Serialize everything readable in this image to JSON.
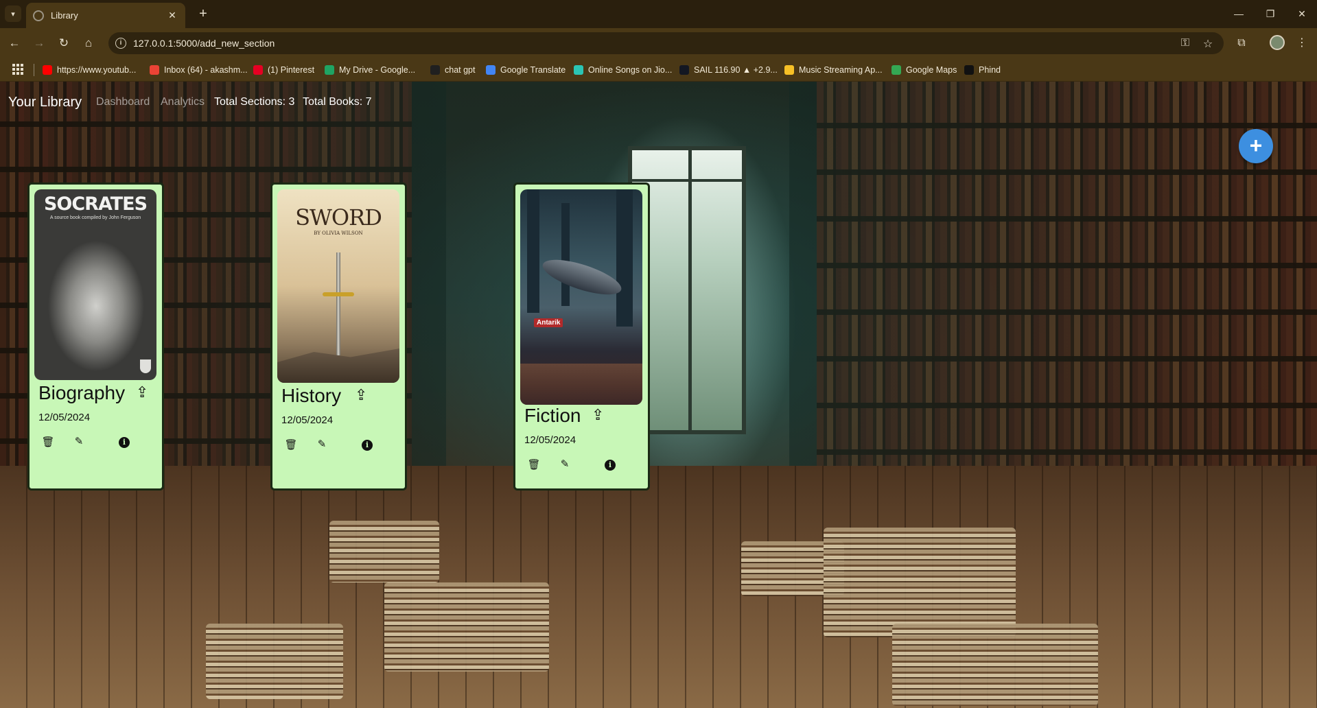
{
  "browser": {
    "tab_title": "Library",
    "url": "127.0.0.1:5000/add_new_section",
    "bookmarks": [
      {
        "label": "https://www.youtub...",
        "icon": "youtube-icon",
        "color": "#ff0000"
      },
      {
        "label": "Inbox (64) - akashm...",
        "icon": "gmail-icon",
        "color": "#ea4335"
      },
      {
        "label": "(1) Pinterest",
        "icon": "pinterest-icon",
        "color": "#e60023"
      },
      {
        "label": "My Drive - Google...",
        "icon": "google-drive-icon",
        "color": "#1fa463"
      },
      {
        "label": "chat gpt",
        "icon": "chatgpt-icon",
        "color": "#202020"
      },
      {
        "label": "Google Translate",
        "icon": "google-translate-icon",
        "color": "#4285f4"
      },
      {
        "label": "Online Songs on Jio...",
        "icon": "jiosaavn-icon",
        "color": "#2bc5b4"
      },
      {
        "label": "SAIL 116.90 ▲ +2.9...",
        "icon": "tradingview-icon",
        "color": "#131722"
      },
      {
        "label": "Music Streaming Ap...",
        "icon": "folder-icon",
        "color": "#f6c026"
      },
      {
        "label": "Google Maps",
        "icon": "google-maps-icon",
        "color": "#34a853"
      },
      {
        "label": "Phind",
        "icon": "phind-icon",
        "color": "#111111"
      }
    ]
  },
  "nav": {
    "brand": "Your Library",
    "links": [
      "Dashboard",
      "Analytics"
    ],
    "total_sections": "Total Sections: 3",
    "total_books": "Total Books: 7"
  },
  "add_button_label": "+",
  "sections": [
    {
      "name": "Biography",
      "date": "12/05/2024",
      "cover_title": "SOCRATES",
      "cover_subtitle": "A source book compiled by John Ferguson"
    },
    {
      "name": "History",
      "date": "12/05/2024",
      "cover_title": "SWORD",
      "cover_subtitle": "BY OLIVIA WILSON"
    },
    {
      "name": "Fiction",
      "date": "12/05/2024",
      "cover_title": "",
      "cover_subtitle": "Antarik"
    }
  ],
  "colors": {
    "card_bg": "#c8f7b7",
    "add_button": "#3d8fe0"
  }
}
